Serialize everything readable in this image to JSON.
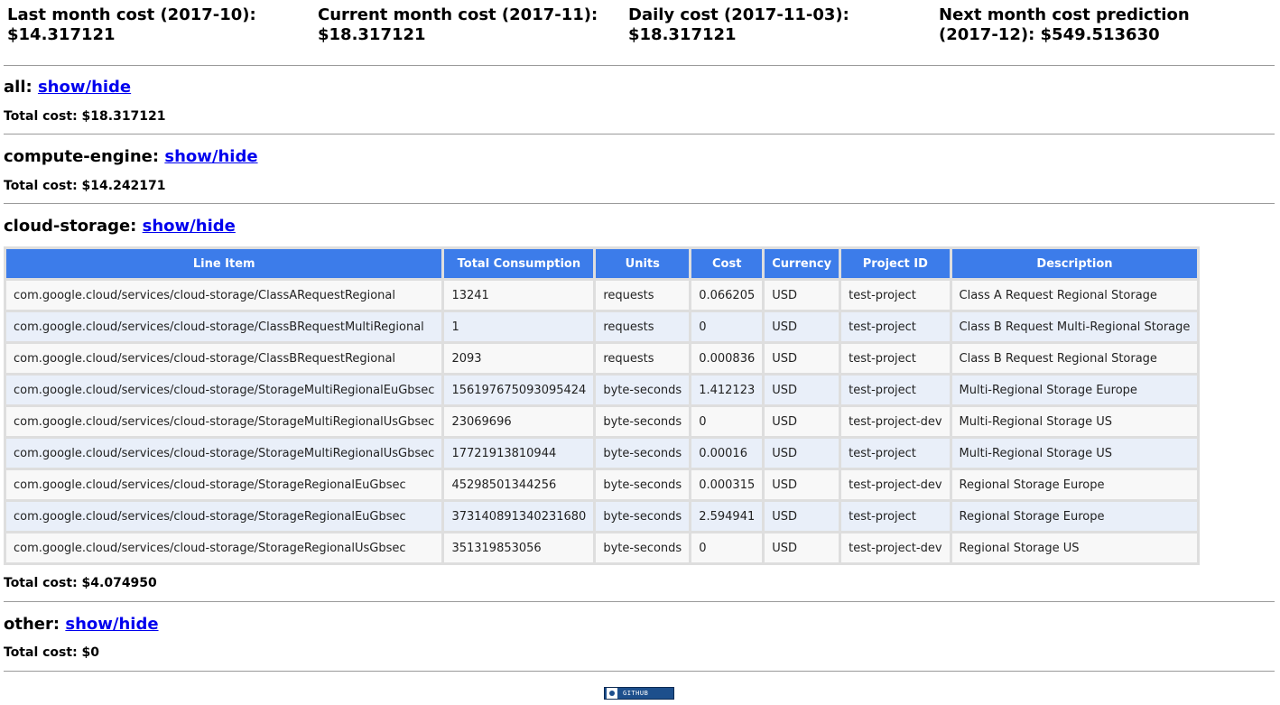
{
  "summary": {
    "last_month_label": "Last month cost (2017-10):",
    "last_month_value": "$14.317121",
    "current_month_label": "Current month cost (2017-11):",
    "current_month_value": "$18.317121",
    "daily_label": "Daily cost (2017-11-03):",
    "daily_value": "$18.317121",
    "prediction_label_line1": "Next month cost prediction",
    "prediction_label_line2": "(2017-12): $549.513630"
  },
  "sections": {
    "all": {
      "name": "all:",
      "toggle": "show/hide",
      "total": "Total cost: $18.317121"
    },
    "compute": {
      "name": "compute-engine:",
      "toggle": "show/hide",
      "total": "Total cost: $14.242171"
    },
    "storage": {
      "name": "cloud-storage:",
      "toggle": "show/hide",
      "total": "Total cost: $4.074950"
    },
    "other": {
      "name": "other:",
      "toggle": "show/hide",
      "total": "Total cost: $0"
    }
  },
  "table": {
    "headers": [
      "Line Item",
      "Total Consumption",
      "Units",
      "Cost",
      "Currency",
      "Project ID",
      "Description"
    ],
    "rows": [
      [
        "com.google.cloud/services/cloud-storage/ClassARequestRegional",
        "13241",
        "requests",
        "0.066205",
        "USD",
        "test-project",
        "Class A Request Regional Storage"
      ],
      [
        "com.google.cloud/services/cloud-storage/ClassBRequestMultiRegional",
        "1",
        "requests",
        "0",
        "USD",
        "test-project",
        "Class B Request Multi-Regional Storage"
      ],
      [
        "com.google.cloud/services/cloud-storage/ClassBRequestRegional",
        "2093",
        "requests",
        "0.000836",
        "USD",
        "test-project",
        "Class B Request Regional Storage"
      ],
      [
        "com.google.cloud/services/cloud-storage/StorageMultiRegionalEuGbsec",
        "156197675093095424",
        "byte-seconds",
        "1.412123",
        "USD",
        "test-project",
        "Multi-Regional Storage Europe"
      ],
      [
        "com.google.cloud/services/cloud-storage/StorageMultiRegionalUsGbsec",
        "23069696",
        "byte-seconds",
        "0",
        "USD",
        "test-project-dev",
        "Multi-Regional Storage US"
      ],
      [
        "com.google.cloud/services/cloud-storage/StorageMultiRegionalUsGbsec",
        "17721913810944",
        "byte-seconds",
        "0.00016",
        "USD",
        "test-project",
        "Multi-Regional Storage US"
      ],
      [
        "com.google.cloud/services/cloud-storage/StorageRegionalEuGbsec",
        "45298501344256",
        "byte-seconds",
        "0.000315",
        "USD",
        "test-project-dev",
        "Regional Storage Europe"
      ],
      [
        "com.google.cloud/services/cloud-storage/StorageRegionalEuGbsec",
        "373140891340231680",
        "byte-seconds",
        "2.594941",
        "USD",
        "test-project",
        "Regional Storage Europe"
      ],
      [
        "com.google.cloud/services/cloud-storage/StorageRegionalUsGbsec",
        "351319853056",
        "byte-seconds",
        "0",
        "USD",
        "test-project-dev",
        "Regional Storage US"
      ]
    ]
  },
  "footer": {
    "badge_text": "GITHUB",
    "badge_icon": "github-icon"
  },
  "colors": {
    "header_bg": "#3c7cea",
    "link": "#0000ee",
    "row_alt": "#e9eff9"
  }
}
